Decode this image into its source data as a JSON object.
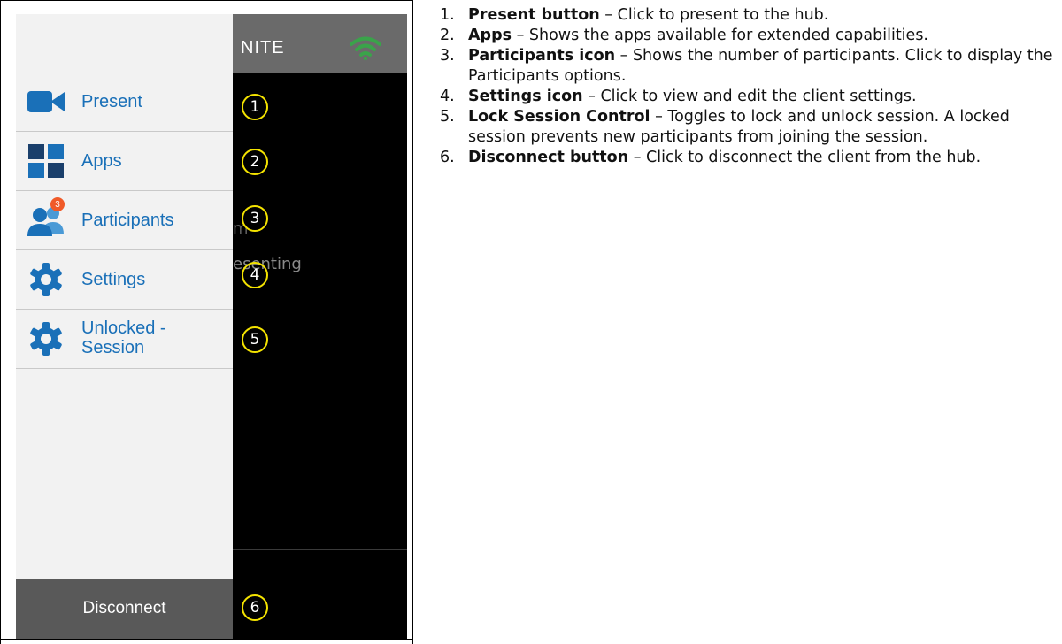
{
  "app": {
    "brand_text": "NITE",
    "wifi_icon": "wifi-icon",
    "background_ghost_text_1": "m",
    "background_ghost_text_2": "esenting"
  },
  "menu": [
    {
      "label": "Present",
      "icon": "video-camera-icon",
      "color": "#1a70b8"
    },
    {
      "label": "Apps",
      "icon": "apps-grid-icon",
      "color": "#1a70b8"
    },
    {
      "label": "Participants",
      "icon": "participants-icon",
      "badge": "3",
      "badge_color": "#f05a28",
      "color": "#1a70b8"
    },
    {
      "label": "Settings",
      "icon": "gear-icon",
      "color": "#1a70b8"
    },
    {
      "label_line1": "Unlocked -",
      "label_line2": "Session",
      "icon": "gear-icon",
      "color": "#1a70b8"
    }
  ],
  "disconnect": {
    "label": "Disconnect",
    "bg": "#595959"
  },
  "callouts": [
    "1",
    "2",
    "3",
    "4",
    "5",
    "6"
  ],
  "callout_color": "#f4e300",
  "descriptions": [
    {
      "num": "1.",
      "title": "Present button",
      "text": " – Click to present to the hub."
    },
    {
      "num": "2.",
      "title": "Apps",
      "text": " – Shows the apps available for extended capabilities."
    },
    {
      "num": "3.",
      "title": "Participants icon",
      "text": " – Shows the number of participants. Click to display the Participants options."
    },
    {
      "num": "4.",
      "title": "Settings icon",
      "text": " – Click to view and edit the client settings."
    },
    {
      "num": "5.",
      "title": "Lock Session Control",
      "text": " – Toggles to lock and unlock session. A locked session prevents new participants from joining the session."
    },
    {
      "num": "6.",
      "title": "Disconnect button",
      "text": " – Click to disconnect the client from the hub."
    }
  ]
}
